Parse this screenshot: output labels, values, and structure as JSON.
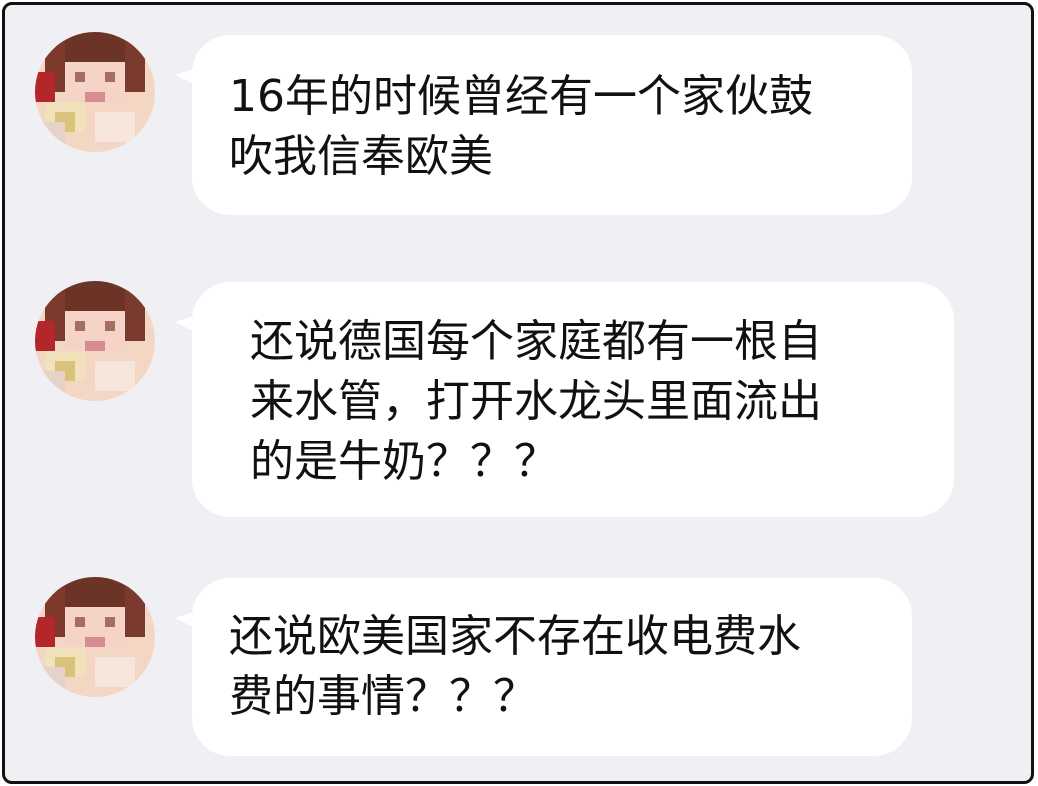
{
  "messages": [
    {
      "text": "16年的时候曾经有一个家伙鼓\n吹我信奉欧美"
    },
    {
      "text": "还说德国每个家庭都有一根自\n来水管，打开水龙头里面流出\n的是牛奶？？？"
    },
    {
      "text": "还说欧美国家不存在收电费水\n费的事情？？？"
    }
  ],
  "colors": {
    "background": "#efeff4",
    "bubble": "#ffffff",
    "text": "#111111",
    "frame": "#111111"
  },
  "icons": {
    "avatar": "pixelated-avatar-icon"
  }
}
